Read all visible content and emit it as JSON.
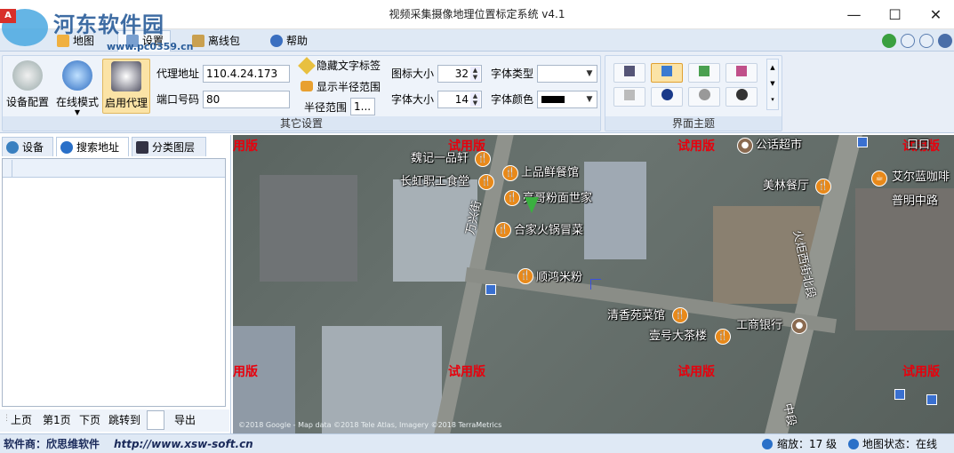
{
  "window": {
    "title": "视频采集摄像地理位置标定系统 v4.1",
    "minimize": "—",
    "maximize": "☐",
    "close": "✕"
  },
  "watermark_logo": {
    "text": "河东软件园",
    "url": "www.pc0359.cn"
  },
  "menu": {
    "items": [
      {
        "label": "地图"
      },
      {
        "label": "设置"
      },
      {
        "label": "离线包"
      },
      {
        "label": "帮助"
      }
    ]
  },
  "ribbon": {
    "device_config": "设备配置",
    "online_mode": "在线模式",
    "enable_proxy": "启用代理",
    "proxy_address_label": "代理地址",
    "proxy_address_value": "110.4.24.173",
    "port_label": "端口号码",
    "port_value": "80",
    "hide_text_label": "隐藏文字标签",
    "show_radius": "显示半径范围",
    "radius_label": "半径范围",
    "radius_value": "1...",
    "icon_size_label": "图标大小",
    "icon_size_value": "32",
    "font_size_label": "字体大小",
    "font_size_value": "14",
    "font_type_label": "字体类型",
    "font_color_label": "字体颜色",
    "other_settings_label": "其它设置",
    "theme_label": "界面主题"
  },
  "left_panel": {
    "tabs": [
      {
        "label": "设备"
      },
      {
        "label": "搜索地址"
      },
      {
        "label": "分类图层"
      }
    ],
    "pager": {
      "prev": "上页",
      "page1": "第1页",
      "next": "下页",
      "jump": "跳转到",
      "export": "导出"
    }
  },
  "map": {
    "pois": [
      {
        "label": "魏记一品轩"
      },
      {
        "label": "上品鲜餐馆"
      },
      {
        "label": "长虹职工食堂"
      },
      {
        "label": "亮哥粉面世家"
      },
      {
        "label": "合家火锅冒菜"
      },
      {
        "label": "顺鸿米粉"
      },
      {
        "label": "清香苑菜馆"
      },
      {
        "label": "壹号大茶楼"
      },
      {
        "label": "工商银行"
      },
      {
        "label": "公话超市"
      },
      {
        "label": "美林餐厅"
      },
      {
        "label": "艾尔蓝咖啡"
      },
      {
        "label": "普明中路"
      },
      {
        "label": "口口"
      }
    ],
    "streets": [
      {
        "label": "万兴街"
      },
      {
        "label": "火炬西街北段"
      },
      {
        "label": "中段"
      }
    ],
    "trial_text": "试用版",
    "trial_text_partial_left": "用版",
    "trial_text_partial_right": "试用版",
    "copyright": "©2018 Google - Map data ©2018 Tele Atlas, Imagery ©2018 TerraMetrics"
  },
  "statusbar": {
    "vendor": "软件商：欣思维软件",
    "url": "http://www.xsw-soft.cn",
    "zoom": "缩放：17 级",
    "map_state": "地图状态：在线"
  },
  "colors": {
    "accent": "#2a5d9a",
    "watermark_red": "#e8000c",
    "poi_orange": "#e8891a"
  }
}
